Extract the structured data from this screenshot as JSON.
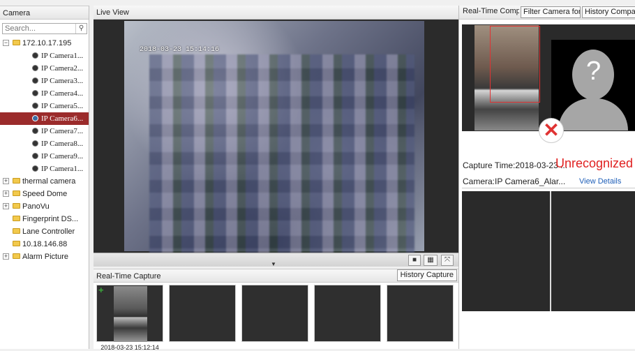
{
  "left": {
    "title": "Camera",
    "search_placeholder": "Search...",
    "tree": [
      {
        "label": "172.10.17.195",
        "type": "folder",
        "expander": "−"
      },
      {
        "label": "IP Camera1...",
        "type": "camera"
      },
      {
        "label": "IP Camera2...",
        "type": "camera"
      },
      {
        "label": "IP Camera3...",
        "type": "camera"
      },
      {
        "label": "IP Camera4...",
        "type": "camera"
      },
      {
        "label": "IP Camera5...",
        "type": "camera"
      },
      {
        "label": "IP Camera6...",
        "type": "camera",
        "selected": true
      },
      {
        "label": "IP Camera7...",
        "type": "camera"
      },
      {
        "label": "IP Camera8...",
        "type": "camera"
      },
      {
        "label": "IP Camera9...",
        "type": "camera"
      },
      {
        "label": "IP Camera1...",
        "type": "camera"
      },
      {
        "label": "thermal camera",
        "type": "folder",
        "expander": "+"
      },
      {
        "label": "Speed Dome",
        "type": "folder",
        "expander": "+"
      },
      {
        "label": "PanoVu",
        "type": "folder",
        "expander": "+"
      },
      {
        "label": "Fingerprint DS...",
        "type": "folder"
      },
      {
        "label": "Lane Controller",
        "type": "folder"
      },
      {
        "label": "10.18.146.88",
        "type": "folder"
      },
      {
        "label": "Alarm Picture",
        "type": "folder",
        "expander": "+"
      }
    ]
  },
  "center": {
    "live_title": "Live View",
    "osd_text": "2018-03-23  15:14:16",
    "capture_title": "Real-Time Capture",
    "history_capture": "History Capture",
    "thumb_time": "2018-03-23 15:12:14",
    "toolbar_icons": [
      "stop-icon",
      "layout-icon",
      "fullscreen-icon"
    ]
  },
  "right": {
    "tabs": [
      "Real-Time Comp...",
      "Filter Camera for ...",
      "History Compariso"
    ],
    "capture_time": "Capture Time:2018-03-23 ...",
    "status": "Unrecognized",
    "camera": "Camera:IP Camera6_Alar...",
    "view_details": "View Details",
    "status_color": "#e02020",
    "accent_selected": "#9b2b2b"
  }
}
